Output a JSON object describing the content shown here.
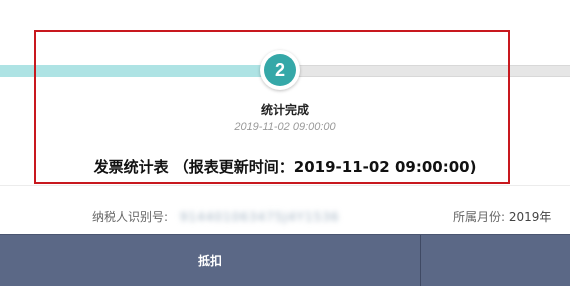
{
  "colors": {
    "track_done": "#aee3e4",
    "step_accent": "#35a8a8",
    "highlight_border": "#c8181e",
    "table_header_bg": "#5b6886"
  },
  "progress": {
    "fraction": 0.5
  },
  "step": {
    "number": "2",
    "title": "统计完成",
    "time": "2019-11-02 09:00:00"
  },
  "report": {
    "title": "发票统计表 （报表更新时间：2019-11-02 09:00:00)"
  },
  "info": {
    "taxpayer_label": "纳税人识别号:",
    "taxpayer_value": "914401063475J4Y1536",
    "month_label": "所属月份:",
    "month_value": "2019年"
  },
  "table": {
    "columns": [
      "抵扣",
      ""
    ]
  }
}
